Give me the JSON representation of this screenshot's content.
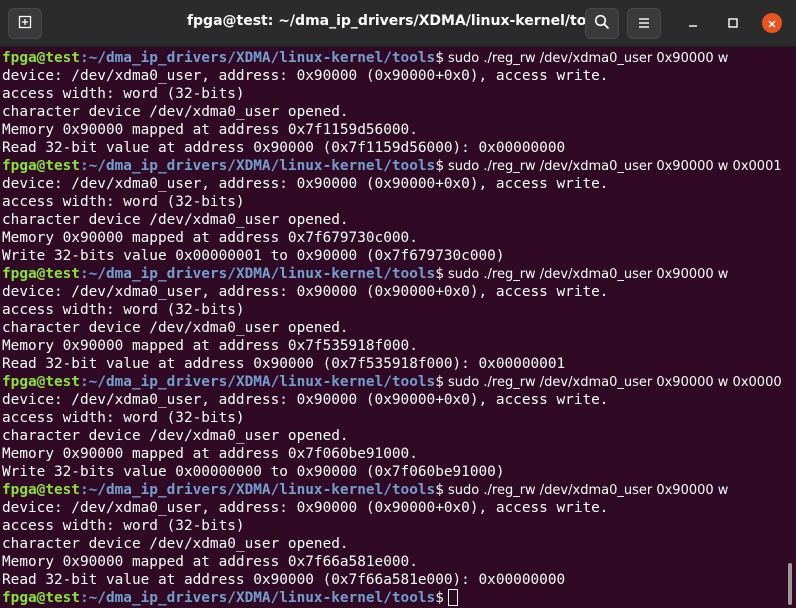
{
  "window": {
    "title": "fpga@test: ~/dma_ip_drivers/XDMA/linux-kernel/tools",
    "icons": {
      "new_tab": "new-tab-icon",
      "search": "search-icon",
      "menu": "hamburger-menu-icon",
      "minimize": "minimize-icon",
      "maximize": "maximize-icon",
      "close": "close-icon"
    },
    "close_color": "#e95420"
  },
  "terminal": {
    "background": "#300a24",
    "prompt_user": "fpga@test",
    "prompt_sep": ":",
    "prompt_path": "~/dma_ip_drivers/XDMA/linux-kernel/tools",
    "prompt_dollar": "$",
    "lines": [
      {
        "type": "prompt",
        "cmd": " sudo ./reg_rw /dev/xdma0_user 0x90000 w"
      },
      {
        "type": "out",
        "text": "device: /dev/xdma0_user, address: 0x90000 (0x90000+0x0), access write."
      },
      {
        "type": "out",
        "text": "access width: word (32-bits)"
      },
      {
        "type": "out",
        "text": "character device /dev/xdma0_user opened."
      },
      {
        "type": "out",
        "text": "Memory 0x90000 mapped at address 0x7f1159d56000."
      },
      {
        "type": "out",
        "text": "Read 32-bit value at address 0x90000 (0x7f1159d56000): 0x00000000"
      },
      {
        "type": "prompt",
        "cmd": " sudo ./reg_rw /dev/xdma0_user 0x90000 w 0x0001"
      },
      {
        "type": "out",
        "text": "device: /dev/xdma0_user, address: 0x90000 (0x90000+0x0), access write."
      },
      {
        "type": "out",
        "text": "access width: word (32-bits)"
      },
      {
        "type": "out",
        "text": "character device /dev/xdma0_user opened."
      },
      {
        "type": "out",
        "text": "Memory 0x90000 mapped at address 0x7f679730c000."
      },
      {
        "type": "out",
        "text": "Write 32-bits value 0x00000001 to 0x90000 (0x7f679730c000)"
      },
      {
        "type": "prompt",
        "cmd": " sudo ./reg_rw /dev/xdma0_user 0x90000 w"
      },
      {
        "type": "out",
        "text": "device: /dev/xdma0_user, address: 0x90000 (0x90000+0x0), access write."
      },
      {
        "type": "out",
        "text": "access width: word (32-bits)"
      },
      {
        "type": "out",
        "text": "character device /dev/xdma0_user opened."
      },
      {
        "type": "out",
        "text": "Memory 0x90000 mapped at address 0x7f535918f000."
      },
      {
        "type": "out",
        "text": "Read 32-bit value at address 0x90000 (0x7f535918f000): 0x00000001"
      },
      {
        "type": "prompt",
        "cmd": " sudo ./reg_rw /dev/xdma0_user 0x90000 w 0x0000"
      },
      {
        "type": "out",
        "text": "device: /dev/xdma0_user, address: 0x90000 (0x90000+0x0), access write."
      },
      {
        "type": "out",
        "text": "access width: word (32-bits)"
      },
      {
        "type": "out",
        "text": "character device /dev/xdma0_user opened."
      },
      {
        "type": "out",
        "text": "Memory 0x90000 mapped at address 0x7f060be91000."
      },
      {
        "type": "out",
        "text": "Write 32-bits value 0x00000000 to 0x90000 (0x7f060be91000)"
      },
      {
        "type": "prompt",
        "cmd": " sudo ./reg_rw /dev/xdma0_user 0x90000 w"
      },
      {
        "type": "out",
        "text": "device: /dev/xdma0_user, address: 0x90000 (0x90000+0x0), access write."
      },
      {
        "type": "out",
        "text": "access width: word (32-bits)"
      },
      {
        "type": "out",
        "text": "character device /dev/xdma0_user opened."
      },
      {
        "type": "out",
        "text": "Memory 0x90000 mapped at address 0x7f66a581e000."
      },
      {
        "type": "out",
        "text": "Read 32-bit value at address 0x90000 (0x7f66a581e000): 0x00000000"
      },
      {
        "type": "prompt",
        "cmd": "",
        "cursor": true
      }
    ]
  }
}
